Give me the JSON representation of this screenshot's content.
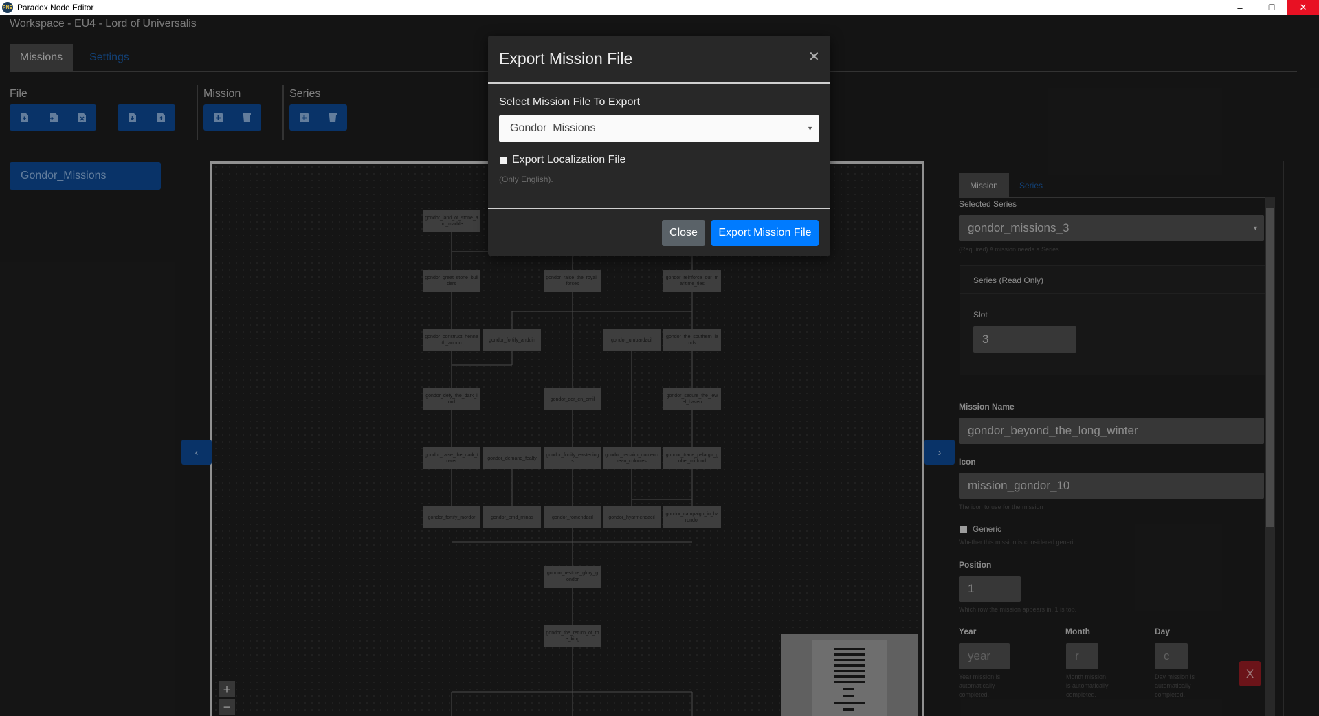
{
  "window": {
    "title": "Paradox Node Editor",
    "logo_text": "PNE",
    "minimize_glyph": "–",
    "maximize_glyph": "❐",
    "close_glyph": "✕"
  },
  "workspace": {
    "title": "Workspace - EU4 - Lord of Universalis"
  },
  "tabs": {
    "missions": "Missions",
    "settings": "Settings"
  },
  "toolbar": {
    "file_label": "File",
    "mission_label": "Mission",
    "series_label": "Series",
    "icons": {
      "new_file": "new-file-icon",
      "import_file": "import-file-icon",
      "close_file": "close-file-icon",
      "save_file": "save-file-icon",
      "export_file": "export-file-icon",
      "add_mission": "add-icon",
      "delete_mission": "trash-icon",
      "add_series": "add-icon",
      "delete_series": "trash-icon"
    }
  },
  "mission_files": [
    "Gondor_Missions"
  ],
  "canvas": {
    "nodes": [
      "gondor_land_of_stone_and_marble",
      "gondor_great_stone_builders",
      "gondor_raise_the_royal_forces",
      "gondor_reinforce_our_maritime_ties",
      "gondor_construct_henneth_annun",
      "gondor_fortify_anduin",
      "gondor_umbardacil",
      "gondor_the_southern_lands",
      "gondor_defy_the_dark_lord",
      "gondor_dor_en_ernil",
      "gondor_secure_the_jewel_haven",
      "gondor_raise_the_dark_tower",
      "gondor_demand_fealty",
      "gondor_fortify_easterlings",
      "gondor_reclaim_numenorean_colonies",
      "gondor_trade_pelargir_gobel_mirlond",
      "gondor_fortify_mordor",
      "gondor_emd_minas",
      "gondor_romendacil",
      "gondor_hyarmendacil",
      "gondor_campaign_in_harondor",
      "gondor_restore_glory_gondor",
      "gondor_the_return_of_the_king"
    ],
    "zoom_in": "+",
    "zoom_out": "−",
    "prev_arrow": "‹",
    "next_arrow": "›"
  },
  "side_panel": {
    "tab_mission": "Mission",
    "tab_series": "Series",
    "selected_series_label": "Selected Series",
    "selected_series_value": "gondor_missions_3",
    "selected_series_help": "(Required) A mission needs a Series",
    "series_readonly_label": "Series (Read Only)",
    "slot_label": "Slot",
    "slot_value": "3",
    "mission_name_label": "Mission Name",
    "mission_name_value": "gondor_beyond_the_long_winter",
    "icon_label": "Icon",
    "icon_value": "mission_gondor_10",
    "icon_help": "The icon to use for the mission",
    "generic_label": "Generic",
    "generic_help": "Whether this mission is considered generic.",
    "position_label": "Position",
    "position_value": "1",
    "position_help": "Which row the mission appears in. 1 is top.",
    "year_label": "Year",
    "year_placeholder": "year",
    "year_help": "Year mission is automatically completed.",
    "month_label": "Month",
    "month_placeholder": "r",
    "month_help": "Month mission is automatically completed.",
    "day_label": "Day",
    "day_placeholder": "c",
    "day_help": "Day mission is automatically completed.",
    "remove_label": "X"
  },
  "modal": {
    "title": "Export Mission File",
    "close_glyph": "✕",
    "select_label": "Select Mission File To Export",
    "selected_file": "Gondor_Missions",
    "caret": "▼",
    "checkbox_label": "Export Localization File",
    "checkbox_help": "(Only English).",
    "close_button": "Close",
    "export_button": "Export Mission File"
  }
}
